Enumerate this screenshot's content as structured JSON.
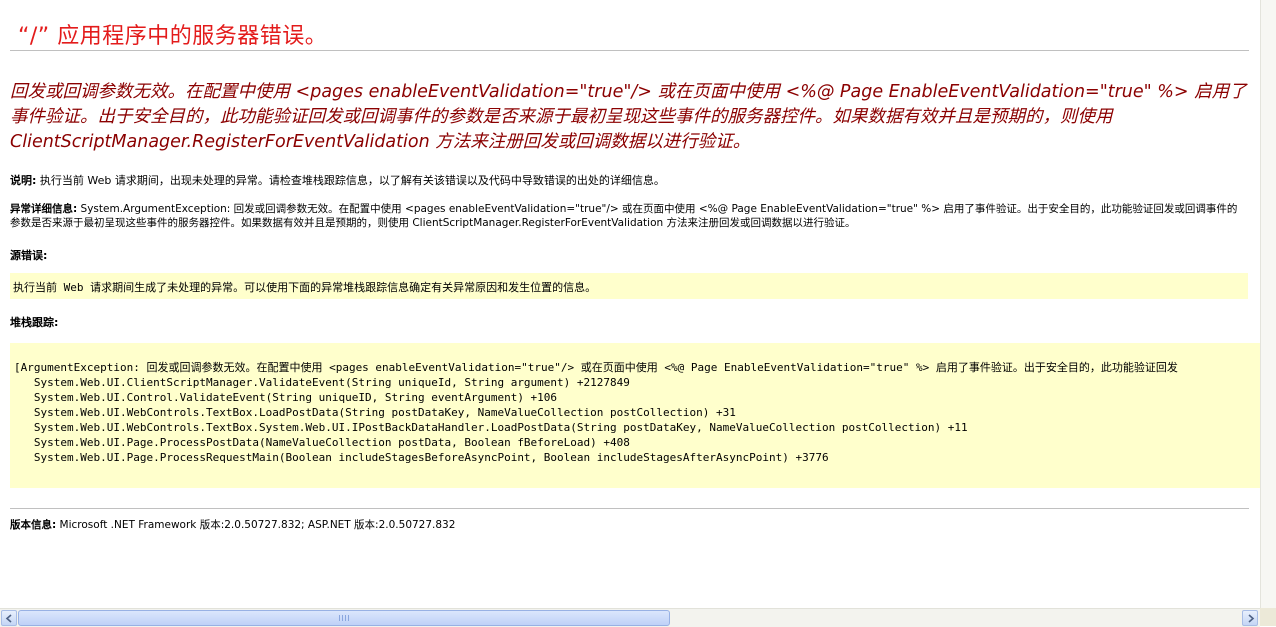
{
  "page": {
    "title": "“/” 应用程序中的服务器错误。",
    "error_message": "回发或回调参数无效。在配置中使用 <pages enableEventValidation=\"true\"/> 或在页面中使用 <%@ Page EnableEventValidation=\"true\" %> 启用了事件验证。出于安全目的，此功能验证回发或回调事件的参数是否来源于最初呈现这些事件的服务器控件。如果数据有效并且是预期的，则使用 ClientScriptManager.RegisterForEventValidation 方法来注册回发或回调数据以进行验证。",
    "description_label": "说明:",
    "description_text": "执行当前 Web 请求期间，出现未处理的异常。请检查堆栈跟踪信息，以了解有关该错误以及代码中导致错误的出处的详细信息。",
    "exception_label": "异常详细信息:",
    "exception_text": "System.ArgumentException: 回发或回调参数无效。在配置中使用 <pages enableEventValidation=\"true\"/> 或在页面中使用 <%@ Page EnableEventValidation=\"true\" %> 启用了事件验证。出于安全目的，此功能验证回发或回调事件的参数是否来源于最初呈现这些事件的服务器控件。如果数据有效并且是预期的，则使用 ClientScriptManager.RegisterForEventValidation 方法来注册回发或回调数据以进行验证。",
    "source_error_label": "源错误:",
    "source_error_text": "执行当前 Web 请求期间生成了未处理的异常。可以使用下面的异常堆栈跟踪信息确定有关异常原因和发生位置的信息。",
    "stack_trace_label": "堆栈跟踪:",
    "stack_trace_lines": [
      "[ArgumentException: 回发或回调参数无效。在配置中使用 <pages enableEventValidation=\"true\"/> 或在页面中使用 <%@ Page EnableEventValidation=\"true\" %> 启用了事件验证。出于安全目的，此功能验证回发",
      "   System.Web.UI.ClientScriptManager.ValidateEvent(String uniqueId, String argument) +2127849",
      "   System.Web.UI.Control.ValidateEvent(String uniqueID, String eventArgument) +106",
      "   System.Web.UI.WebControls.TextBox.LoadPostData(String postDataKey, NameValueCollection postCollection) +31",
      "   System.Web.UI.WebControls.TextBox.System.Web.UI.IPostBackDataHandler.LoadPostData(String postDataKey, NameValueCollection postCollection) +11",
      "   System.Web.UI.Page.ProcessPostData(NameValueCollection postData, Boolean fBeforeLoad) +408",
      "   System.Web.UI.Page.ProcessRequestMain(Boolean includeStagesBeforeAsyncPoint, Boolean includeStagesAfterAsyncPoint) +3776"
    ],
    "version_label": "版本信息:",
    "version_text": "Microsoft .NET Framework 版本:2.0.50727.832; ASP.NET 版本:2.0.50727.832"
  },
  "colors": {
    "title": "#e31b1b",
    "error_message": "#8b0000",
    "code_background": "#ffffcc"
  },
  "scrollbar": {
    "left_icon": "arrow-left-icon",
    "right_icon": "arrow-right-icon"
  }
}
